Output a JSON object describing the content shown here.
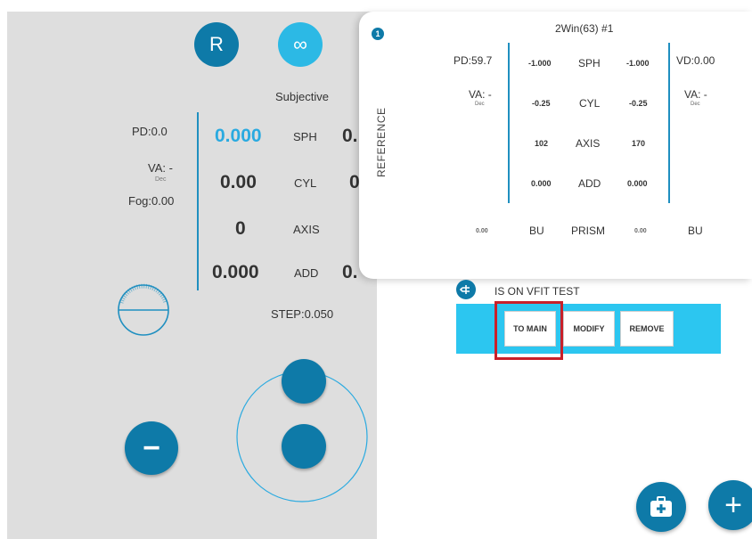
{
  "left": {
    "eye_button": "R",
    "infinity_button": "∞",
    "mode": "Subjective",
    "pd": "PD:0.0",
    "va": "VA: -",
    "va_unit": "Dec",
    "fog": "Fog:0.00",
    "sph_value": "0.000",
    "sph_label": "SPH",
    "sph_value2": "0.",
    "cyl_value": "0.00",
    "cyl_label": "CYL",
    "cyl_value2": "0",
    "axis_value": "0",
    "axis_label": "AXIS",
    "add_value": "0.000",
    "add_label": "ADD",
    "add_value2": "0.",
    "step": "STEP:0.050",
    "minus_button": "−"
  },
  "reference": {
    "badge": "1",
    "tab_label": "REFERENCE",
    "title": "2Win(63) #1",
    "pd": "PD:59.7",
    "vd": "VD:0.00",
    "va_left": "VA: -",
    "va_left_unit": "Dec",
    "va_right": "VA: -",
    "va_right_unit": "Dec",
    "rows": [
      {
        "label": "SPH",
        "left": "-1.000",
        "right": "-1.000"
      },
      {
        "label": "CYL",
        "left": "-0.25",
        "right": "-0.25"
      },
      {
        "label": "AXIS",
        "left": "102",
        "right": "170"
      },
      {
        "label": "ADD",
        "left": "0.000",
        "right": "0.000"
      }
    ],
    "prism": {
      "label": "PRISM",
      "left_value": "0.00",
      "left_base": "BU",
      "right_value": "0.00",
      "right_base": "BU"
    }
  },
  "vfit": {
    "status": "IS ON VFIT TEST",
    "buttons": [
      "TO MAIN",
      "MODIFY",
      "REMOVE"
    ]
  },
  "fab": {
    "plus": "+"
  },
  "colors": {
    "dark_blue": "#0e7aa8",
    "light_blue": "#2cb9e5",
    "highlight_red": "#c8202a",
    "panel_grey": "#dedede"
  }
}
